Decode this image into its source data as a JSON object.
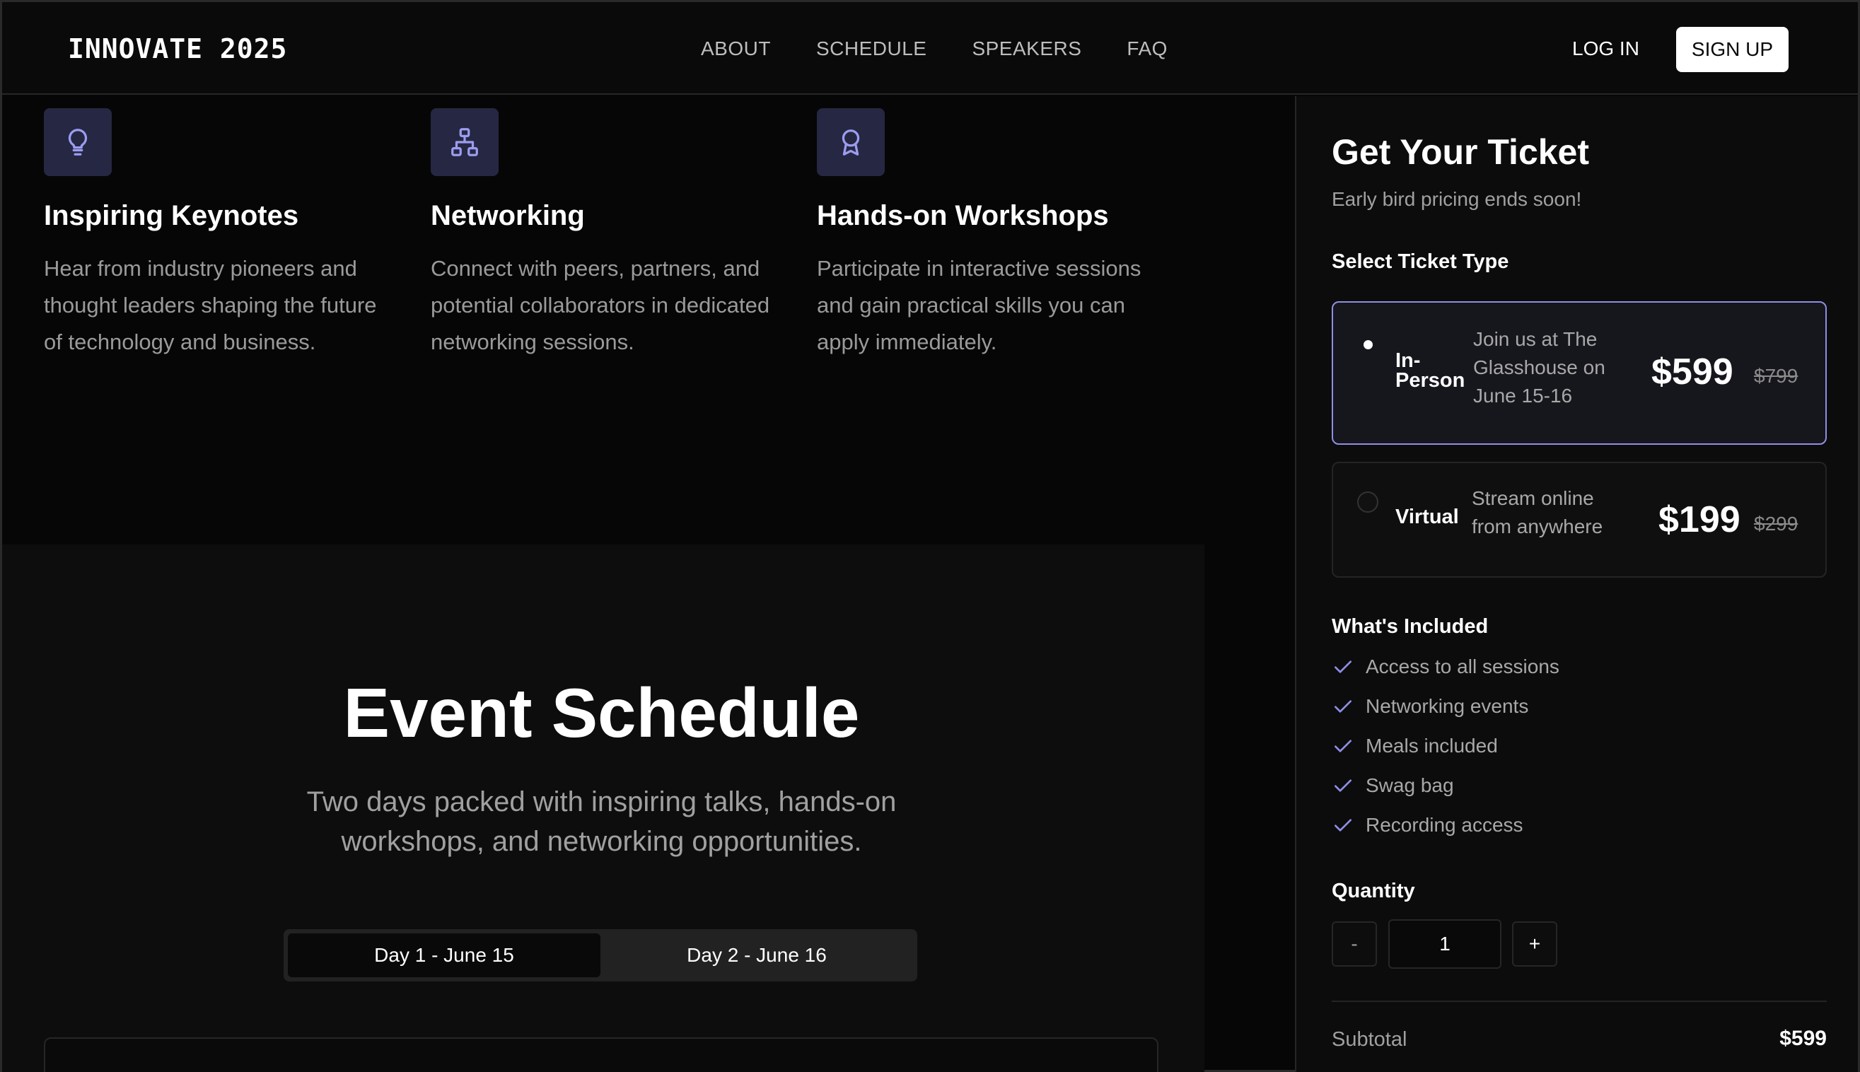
{
  "nav": {
    "logo": "INNOVATE 2025",
    "links": [
      "ABOUT",
      "SCHEDULE",
      "SPEAKERS",
      "FAQ"
    ],
    "login": "LOG IN",
    "signup": "SIGN UP"
  },
  "features": [
    {
      "icon": "lightbulb-icon",
      "title": "Inspiring Keynotes",
      "text": "Hear from industry pioneers and thought leaders shaping the future of technology and business."
    },
    {
      "icon": "network-icon",
      "title": "Networking",
      "text": "Connect with peers, partners, and potential collaborators in dedicated networking sessions."
    },
    {
      "icon": "award-icon",
      "title": "Hands-on Workshops",
      "text": "Participate in interactive sessions and gain practical skills you can apply immediately."
    }
  ],
  "schedule": {
    "title": "Event Schedule",
    "subtitle": "Two days packed with inspiring talks, hands-on workshops, and networking opportunities.",
    "tabs": [
      "Day 1 - June 15",
      "Day 2 - June 16"
    ],
    "active_tab": "Day 1 - June 15"
  },
  "ticket": {
    "title": "Get Your Ticket",
    "subtitle": "Early bird pricing ends soon!",
    "select_label": "Select Ticket Type",
    "options": [
      {
        "name": "In-Person",
        "desc": "Join us at The Glasshouse on June 15-16",
        "price": "$599",
        "old_price": "$799",
        "selected": true
      },
      {
        "name": "Virtual",
        "desc": "Stream online from anywhere",
        "price": "$199",
        "old_price": "$299",
        "selected": false
      }
    ],
    "included_label": "What's Included",
    "included": [
      "Access to all sessions",
      "Networking events",
      "Meals included",
      "Swag bag",
      "Recording access"
    ],
    "quantity_label": "Quantity",
    "quantity": "1",
    "minus": "-",
    "plus": "+",
    "subtotal_label": "Subtotal",
    "subtotal": "$599"
  },
  "colors": {
    "accent": "#8f8ee6",
    "icon_bg": "#262742"
  }
}
